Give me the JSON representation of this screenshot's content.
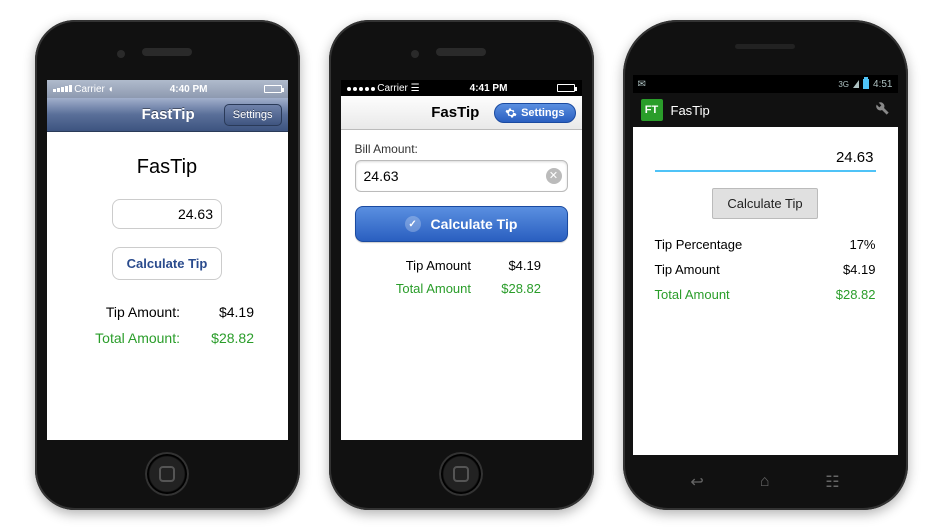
{
  "phone1": {
    "status": {
      "carrier": "Carrier",
      "time": "4:40 PM"
    },
    "nav": {
      "title": "FastTip",
      "settings": "Settings"
    },
    "heading": "FasTip",
    "bill_value": "24.63",
    "calc_label": "Calculate Tip",
    "tip_label": "Tip Amount:",
    "tip_value": "$4.19",
    "total_label": "Total Amount:",
    "total_value": "$28.82"
  },
  "phone2": {
    "status": {
      "carrier": "Carrier",
      "time": "4:41 PM"
    },
    "nav": {
      "title": "FasTip",
      "settings": "Settings"
    },
    "field_label": "Bill Amount:",
    "bill_value": "24.63",
    "calc_label": "Calculate Tip",
    "tip_label": "Tip Amount",
    "tip_value": "$4.19",
    "total_label": "Total Amount",
    "total_value": "$28.82"
  },
  "phone3": {
    "status": {
      "time": "4:51",
      "network": "3G"
    },
    "action": {
      "logo": "FT",
      "title": "FasTip"
    },
    "bill_value": "24.63",
    "calc_label": "Calculate Tip",
    "pct_label": "Tip Percentage",
    "pct_value": "17%",
    "tip_label": "Tip Amount",
    "tip_value": "$4.19",
    "total_label": "Total Amount",
    "total_value": "$28.82"
  }
}
